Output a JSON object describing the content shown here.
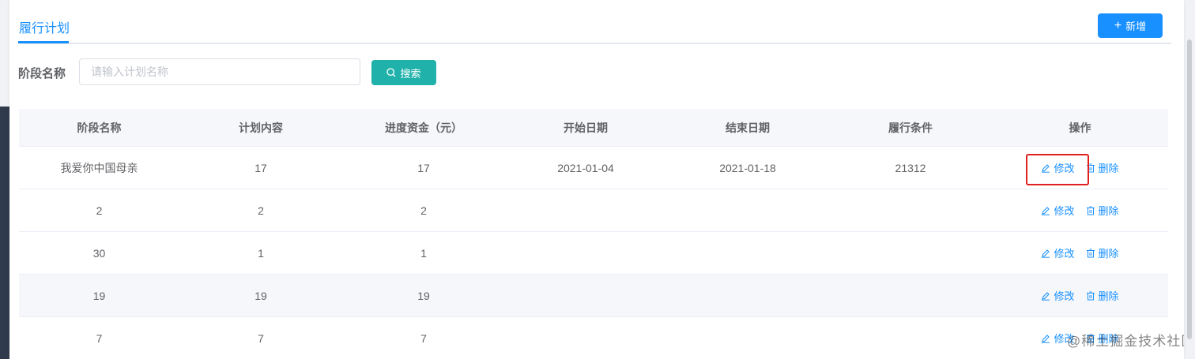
{
  "tabs": {
    "active_label": "履行计划",
    "add_label": "新增"
  },
  "search": {
    "label": "阶段名称",
    "placeholder": "请输入计划名称",
    "value": "",
    "button_label": "搜索"
  },
  "table": {
    "headers": [
      "阶段名称",
      "计划内容",
      "进度资金（元）",
      "开始日期",
      "结束日期",
      "履行条件",
      "操作"
    ],
    "edit_label": "修改",
    "delete_label": "删除",
    "rows": [
      [
        "我爱你中国母亲",
        "17",
        "17",
        "2021-01-04",
        "2021-01-18",
        "21312"
      ],
      [
        "2",
        "2",
        "2",
        "",
        "",
        ""
      ],
      [
        "30",
        "1",
        "1",
        "",
        "",
        ""
      ],
      [
        "19",
        "19",
        "19",
        "",
        "",
        ""
      ],
      [
        "7",
        "7",
        "7",
        "",
        "",
        ""
      ]
    ]
  },
  "watermark": "@稀土掘金技术社区",
  "colors": {
    "primary": "#1890ff",
    "search_button": "#20b2aa",
    "highlight_border": "#e02020"
  }
}
